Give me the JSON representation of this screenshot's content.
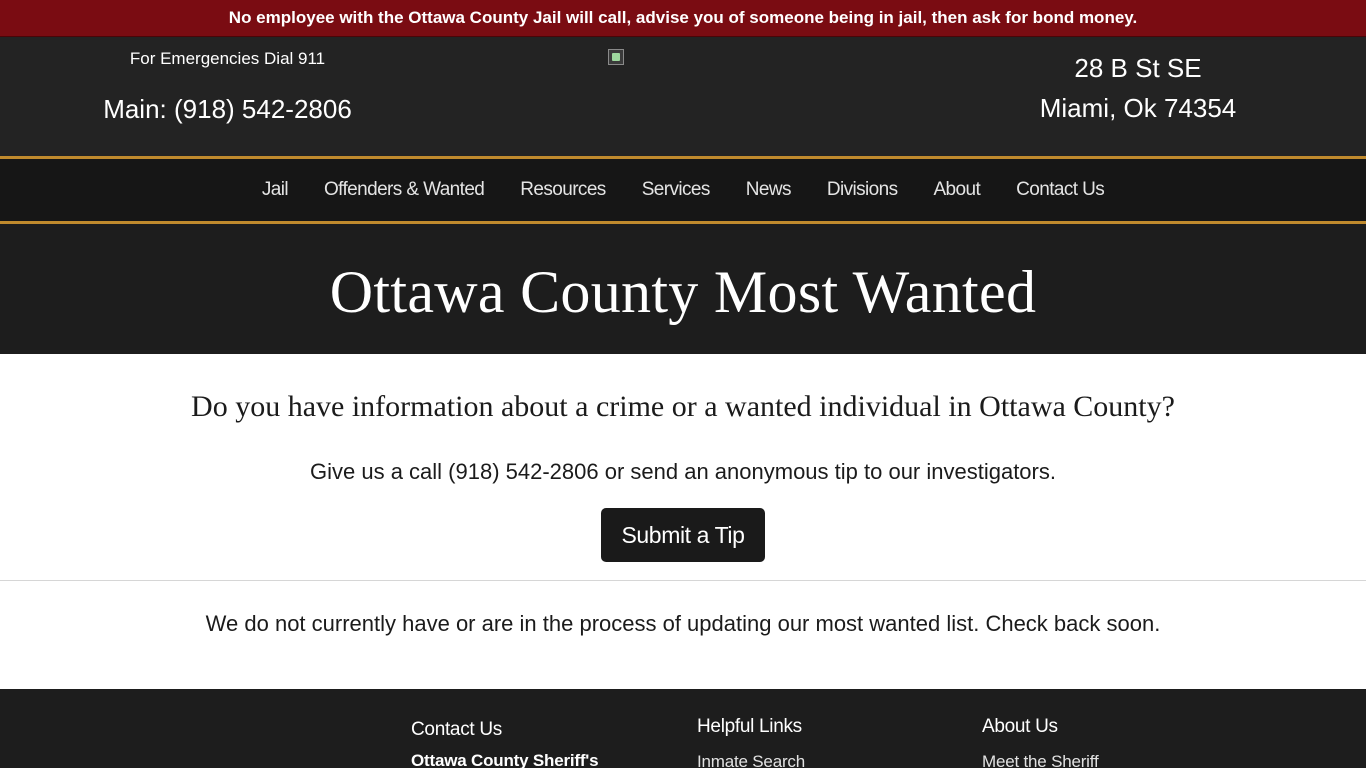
{
  "alert": {
    "text": "No employee with the Ottawa County Jail will call, advise you of someone being in jail, then ask for bond money."
  },
  "header": {
    "emergency": "For Emergencies Dial 911",
    "main_phone": "Main: (918) 542-2806",
    "logo_icon": "broken-image-icon",
    "address_line1": "28 B St SE",
    "address_line2": "Miami, Ok 74354"
  },
  "nav": {
    "items": [
      {
        "label": "Jail"
      },
      {
        "label": "Offenders & Wanted"
      },
      {
        "label": "Resources"
      },
      {
        "label": "Services"
      },
      {
        "label": "News"
      },
      {
        "label": "Divisions"
      },
      {
        "label": "About"
      },
      {
        "label": "Contact Us"
      }
    ]
  },
  "hero": {
    "title": "Ottawa County Most Wanted"
  },
  "content": {
    "question": "Do you have information about a crime or a wanted individual in Ottawa County?",
    "call_text": "Give us a call (918) 542-2806 or send an anonymous tip to our investigators.",
    "tip_button": "Submit a Tip",
    "wanted_note": "We do not currently have or are in the process of updating our most wanted list. Check back soon."
  },
  "footer": {
    "contact": {
      "heading": "Contact Us",
      "org": "Ottawa County Sheriff's"
    },
    "helpful": {
      "heading": "Helpful Links",
      "first_link": "Inmate Search"
    },
    "about": {
      "heading": "About Us",
      "first_link": "Meet the Sheriff"
    }
  },
  "colors": {
    "alert_bg": "#7a0c12",
    "header_bg": "#232323",
    "nav_bg": "#161616",
    "accent_gold": "#c08a2d",
    "hero_bg": "#1d1d1d",
    "button_bg": "#1a1a1a"
  }
}
